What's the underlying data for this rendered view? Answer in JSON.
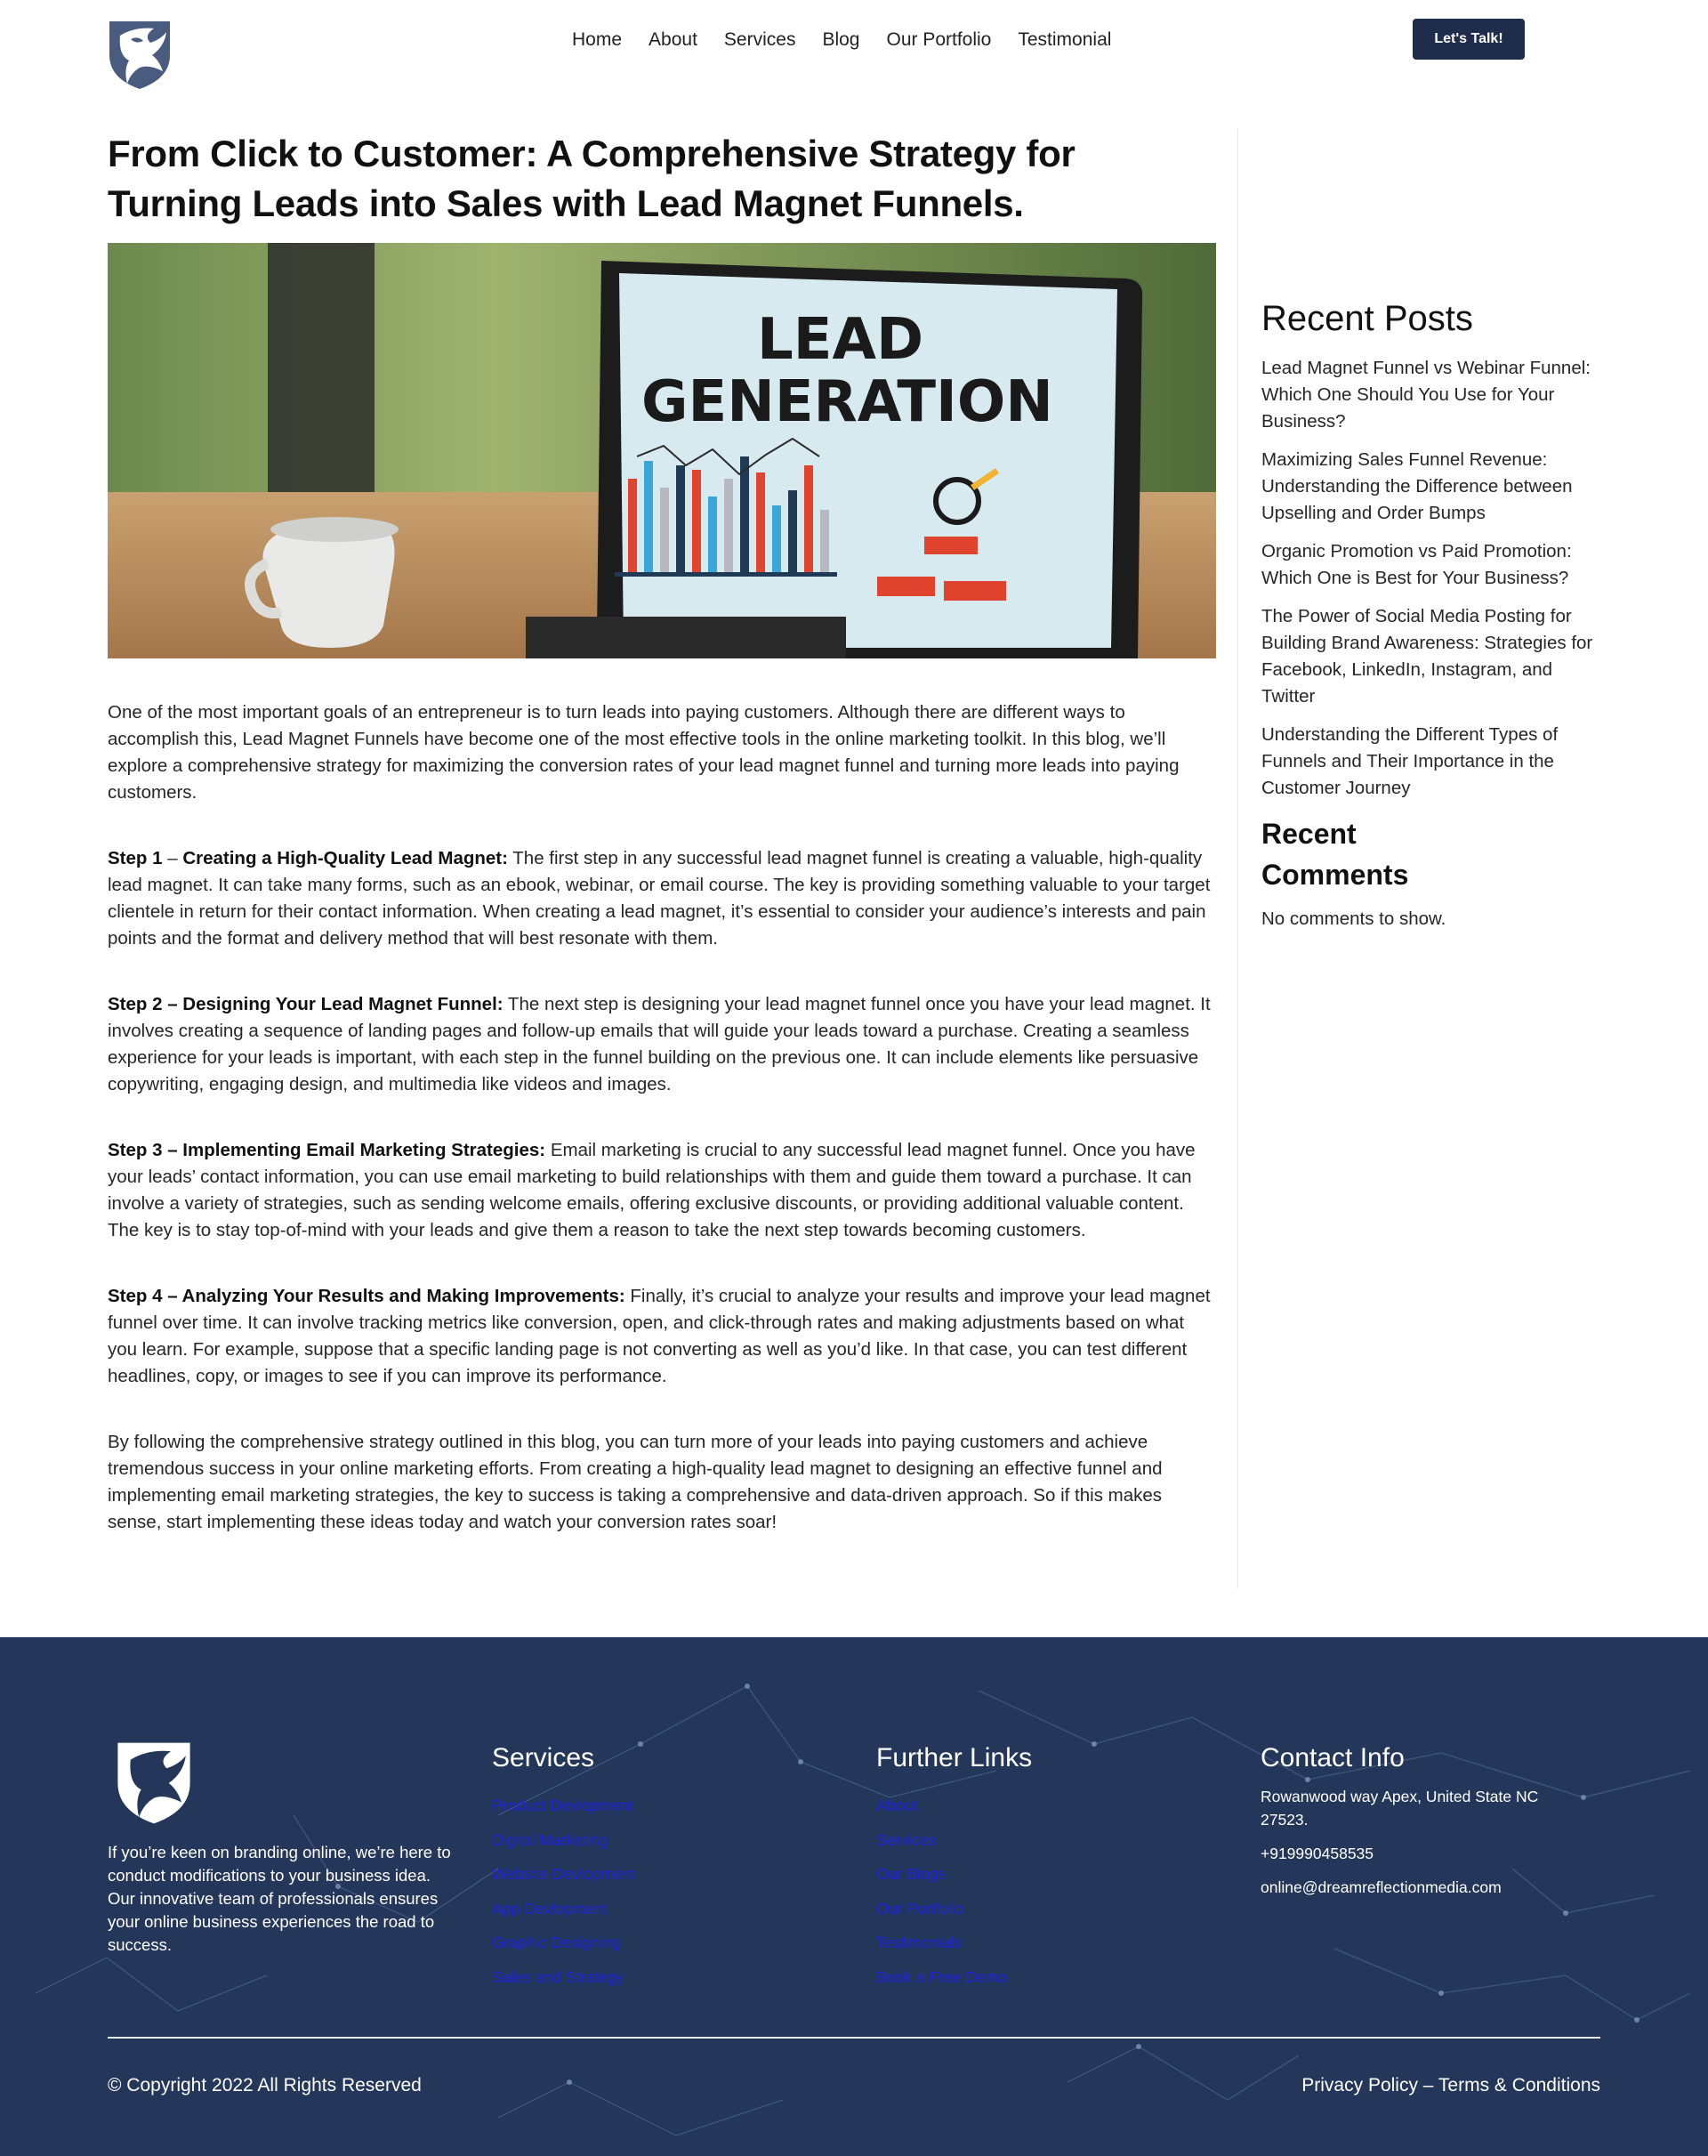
{
  "nav": {
    "items": [
      "Home",
      "About",
      "Services",
      "Blog",
      "Our Portfolio",
      "Testimonial"
    ],
    "cta_label": "Let's Talk!"
  },
  "article": {
    "title": "From Click to Customer: A Comprehensive Strategy for Turning Leads into Sales with Lead Magnet Funnels.",
    "hero_text_line1": "LEAD",
    "hero_text_line2": "GENERATION",
    "intro": "One of the most important goals of an entrepreneur is to turn leads into paying customers. Although there are different ways to accomplish this, Lead Magnet Funnels have become one of the most effective tools in the online marketing toolkit. In this blog, we’ll explore a comprehensive strategy for maximizing the conversion rates of your lead magnet funnel and turning more leads into paying customers.",
    "steps": [
      {
        "heading_prefix": "Step 1",
        "heading_sep": " – ",
        "heading": "Creating a High-Quality Lead Magnet:",
        "body": " The first step in any successful lead magnet funnel is creating a valuable, high-quality lead magnet. It can take many forms, such as an ebook, webinar, or email course. The key is providing something valuable to your target clientele in return for their contact information. When creating a lead magnet, it’s essential to consider your audience’s interests and pain points and the format and delivery method that will best resonate with them."
      },
      {
        "heading_prefix": "",
        "heading_sep": "",
        "heading": "Step 2 – Designing Your Lead Magnet Funnel:",
        "body": " The next step is designing your lead magnet funnel once you have your lead magnet. It involves creating a sequence of landing pages and follow-up emails that will guide your leads toward a purchase. Creating a seamless experience for your leads is important, with each step in the funnel building on the previous one. It can include elements like persuasive copywriting, engaging design, and multimedia like videos and images."
      },
      {
        "heading_prefix": "",
        "heading_sep": "",
        "heading": "Step 3 – Implementing Email Marketing Strategies:",
        "body": " Email marketing is crucial to any successful lead magnet funnel. Once you have your leads’ contact information, you can use email marketing to build relationships with them and guide them toward a purchase. It can involve a variety of strategies, such as sending welcome emails, offering exclusive discounts, or providing additional valuable content. The key is to stay top-of-mind with your leads and give them a reason to take the next step towards becoming customers."
      },
      {
        "heading_prefix": "",
        "heading_sep": "",
        "heading": "Step 4 – Analyzing Your Results and Making Improvements:",
        "body": " Finally, it’s crucial to analyze your results and improve your lead magnet funnel over time. It can involve tracking metrics like conversion, open, and click-through rates and making adjustments based on what you learn. For example, suppose that a specific landing page is not converting as well as you’d like. In that case, you can test different headlines, copy, or images to see if you can improve its performance."
      }
    ],
    "conclusion": "By following the comprehensive strategy outlined in this blog, you can turn more of your leads into paying customers and achieve tremendous success in your online marketing efforts. From creating a high-quality lead magnet to designing an effective funnel and implementing email marketing strategies, the key to success is taking a comprehensive and data-driven approach. So if this makes sense, start implementing these ideas today and watch your conversion rates soar!"
  },
  "sidebar": {
    "recent_posts_title": "Recent Posts",
    "recent_posts": [
      "Lead Magnet Funnel vs Webinar Funnel: Which One Should You Use for Your Business?",
      "Maximizing Sales Funnel Revenue: Understanding the Difference between Upselling and Order Bumps",
      "Organic Promotion vs Paid Promotion: Which One is Best for Your Business?",
      "The Power of Social Media Posting for Building Brand Awareness: Strategies for Facebook, LinkedIn, Instagram, and Twitter",
      "Understanding the Different Types of Funnels and Their Importance in the Customer Journey"
    ],
    "recent_comments_title": "Recent Comments",
    "no_comments": "No comments to show."
  },
  "footer": {
    "about": "If you’re keen on branding online, we’re here to conduct modifications to your business idea. Our innovative team of professionals ensures your online business experiences the road to success.",
    "services_title": "Services",
    "services": [
      "Product Devlopment",
      "Digital Marketing",
      "Website Devlopment",
      "App Devlopment",
      "Graphic Designing",
      "Sales and Strategy"
    ],
    "links_title": "Further Links",
    "links": [
      "About",
      "Services",
      "Our Blogs",
      "Our Portfolio",
      "Testimonials",
      "Book a Free Demo"
    ],
    "contact_title": "Contact Info",
    "address": "Rowanwood way Apex, United State NC 27523.",
    "phone": "+919990458535",
    "email": "online@dreamreflectionmedia.com",
    "copyright": "© Copyright 2022 All Rights Reserved",
    "legal": "Privacy Policy – Terms & Conditions"
  },
  "colors": {
    "brand_navy": "#1f2d4d",
    "footer_bg": "#24365a",
    "footer_link": "#2222dd"
  }
}
